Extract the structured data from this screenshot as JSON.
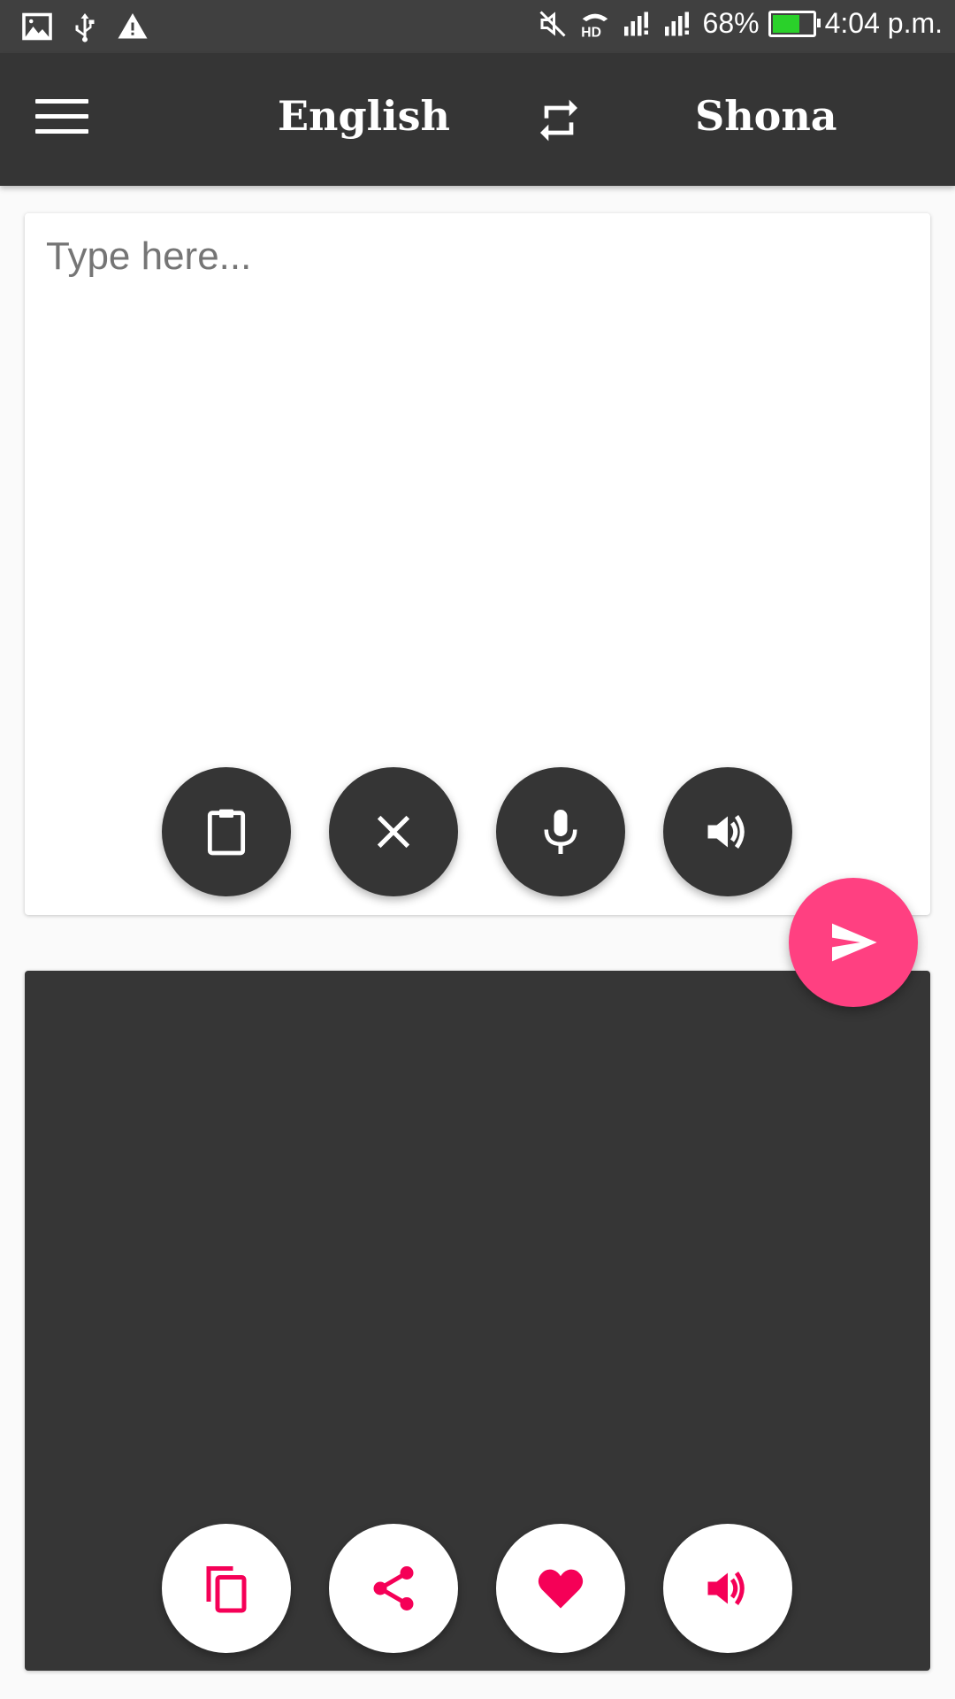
{
  "status_bar": {
    "left_icons": [
      "image-icon",
      "usb-icon",
      "warning-icon"
    ],
    "right_icons": [
      "mute-icon",
      "hd-call-icon",
      "signal-sim1-icon",
      "signal-sim2-icon"
    ],
    "battery_percent_text": "68%",
    "battery_level": 0.68,
    "battery_color": "#2ad12a",
    "time": "4:04 p.m."
  },
  "app_bar": {
    "menu_icon": "hamburger-menu-icon",
    "source_language": "English",
    "swap_icon": "swap-languages-icon",
    "target_language": "Shona"
  },
  "input_card": {
    "placeholder": "Type here...",
    "value": "",
    "actions": [
      {
        "name": "paste",
        "icon": "clipboard-icon"
      },
      {
        "name": "clear",
        "icon": "close-icon"
      },
      {
        "name": "voice-input",
        "icon": "microphone-icon"
      },
      {
        "name": "speak-input",
        "icon": "speaker-icon"
      }
    ]
  },
  "translate_button": {
    "icon": "send-icon",
    "color": "#ff4081"
  },
  "output_card": {
    "value": "",
    "actions": [
      {
        "name": "copy",
        "icon": "copy-icon"
      },
      {
        "name": "share",
        "icon": "share-icon"
      },
      {
        "name": "favorite",
        "icon": "heart-icon"
      },
      {
        "name": "speak-output",
        "icon": "speaker-icon"
      }
    ],
    "accent_color": "#f50057"
  }
}
